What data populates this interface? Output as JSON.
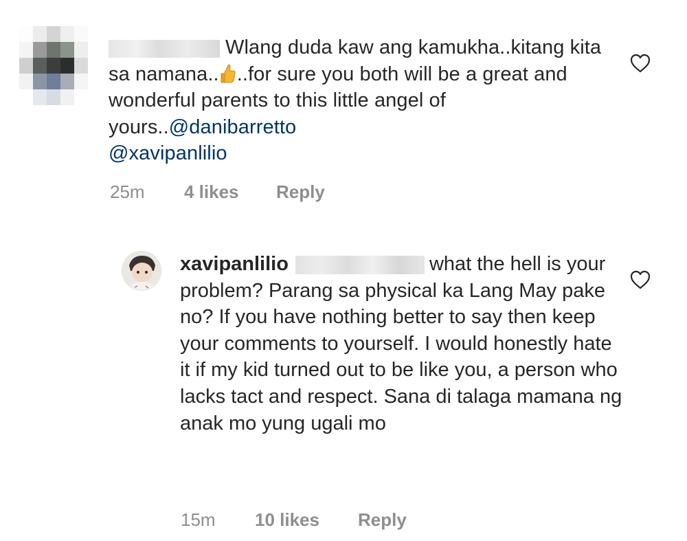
{
  "comment": {
    "text_before_emoji": "Wlang duda kaw ang kamukha..kitang kita sa namana..",
    "emoji": "👍",
    "text_after_emoji": "..for sure you both will be a great and wonderful parents to this little angel of yours..",
    "mentions": [
      "@danibarretto",
      "@xavipanlilio"
    ],
    "time": "25m",
    "likes": "4 likes",
    "reply_label": "Reply",
    "like_icon": "heart-outline-icon"
  },
  "reply": {
    "username": "xavipanlilio",
    "text": "what the hell is your problem? Parang sa physical ka Lang May pake no? If you have nothing better to say then keep your comments to yourself. I would honestly hate it if my kid turned out to be like you, a person who lacks tact and respect. Sana di talaga mamana ng anak mo yung ugali mo",
    "time": "15m",
    "likes": "10 likes",
    "reply_label": "Reply",
    "like_icon": "heart-outline-icon"
  },
  "colors": {
    "text": "#262626",
    "meta": "#8e8e8e",
    "mention": "#003569",
    "background": "#ffffff"
  }
}
